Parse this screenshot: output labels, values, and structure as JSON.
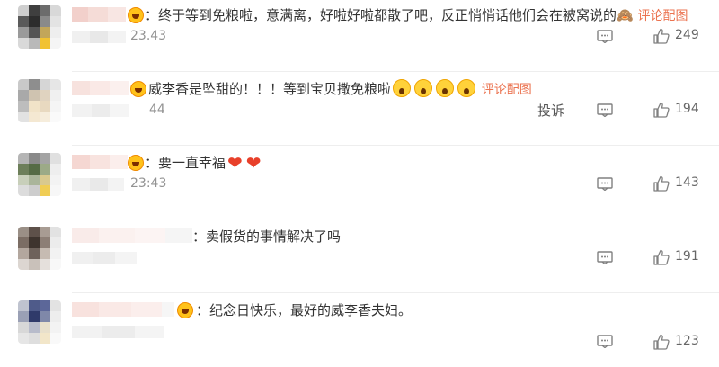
{
  "comments": [
    {
      "text": "：终于等到免粮啦，意满离，好啦好啦都散了吧，反正悄悄话他们会在被窝说的",
      "time": "23.43",
      "likes": "249",
      "link": "评论配图",
      "emoji_trail": "🙈",
      "report": ""
    },
    {
      "text": "威李香是坠甜的！！！等到宝贝撒免粮啦",
      "time": "44",
      "likes": "194",
      "link": "评论配图",
      "report": "投诉"
    },
    {
      "text": "：要一直幸福",
      "time": "23:43",
      "likes": "143",
      "link": "",
      "report": ""
    },
    {
      "text": "：卖假货的事情解决了吗",
      "time": "",
      "likes": "191",
      "link": "",
      "report": ""
    },
    {
      "text": "：纪念日快乐，最好的威李香夫妇。",
      "time": "",
      "likes": "123",
      "link": "",
      "report": ""
    }
  ],
  "icons": {
    "reply": "comment-bubble-icon",
    "like": "thumbs-up-icon",
    "emoji_fear": "scream-emoji-icon",
    "heart": "heart-icon",
    "badge": "fan-badge-icon"
  },
  "colors": {
    "link": "#eb7350",
    "text": "#333333",
    "meta": "#939393"
  }
}
